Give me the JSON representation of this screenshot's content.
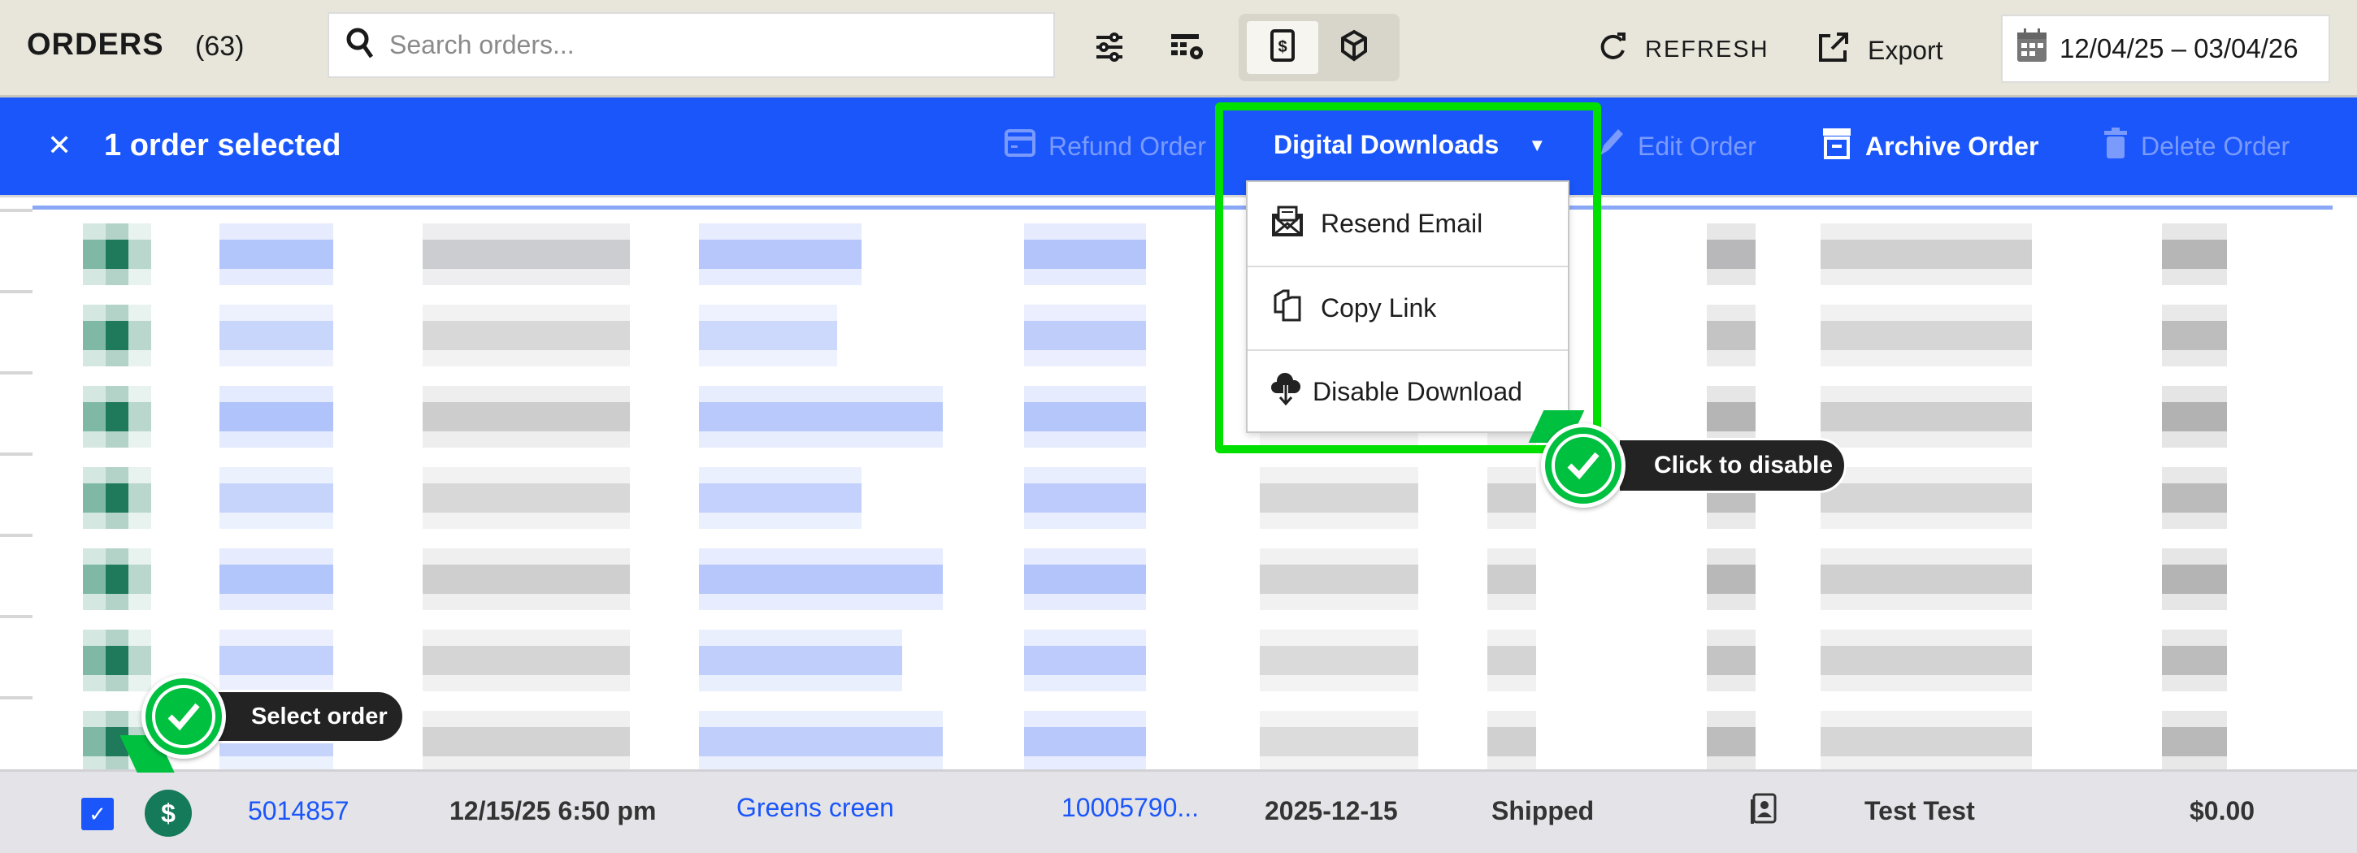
{
  "header": {
    "title": "ORDERS",
    "count": "(63)",
    "search_placeholder": "Search orders...",
    "view_toggle": {
      "active": "revenue",
      "options": [
        "revenue-icon",
        "package-icon"
      ]
    },
    "refresh_label": "REFRESH",
    "export_label": "Export",
    "date_range": "12/04/25 – 03/04/26"
  },
  "selection_bar": {
    "selected_text": "1 order selected",
    "actions": {
      "refund": "Refund Order",
      "digital_downloads": "Digital Downloads",
      "edit": "Edit Order",
      "archive": "Archive Order",
      "delete": "Delete Order"
    }
  },
  "dropdown": {
    "items": [
      {
        "label": "Resend Email",
        "icon": "envelope-icon"
      },
      {
        "label": "Copy Link",
        "icon": "copy-icon"
      },
      {
        "label": "Disable Download",
        "icon": "cloud-download-icon"
      }
    ]
  },
  "callouts": {
    "disable": "Click to disable",
    "select": "Select order"
  },
  "selected_row": {
    "checked": true,
    "order_id": "5014857",
    "datetime": "12/15/25 6:50 pm",
    "product": "Greens creen",
    "reference": "10005790...",
    "date": "2025-12-15",
    "status": "Shipped",
    "customer": "Test Test",
    "total": "$0.00"
  },
  "colors": {
    "accent": "#1a56fa",
    "highlight": "#00e000",
    "callout": "#00c040",
    "paid": "#157a5a"
  }
}
